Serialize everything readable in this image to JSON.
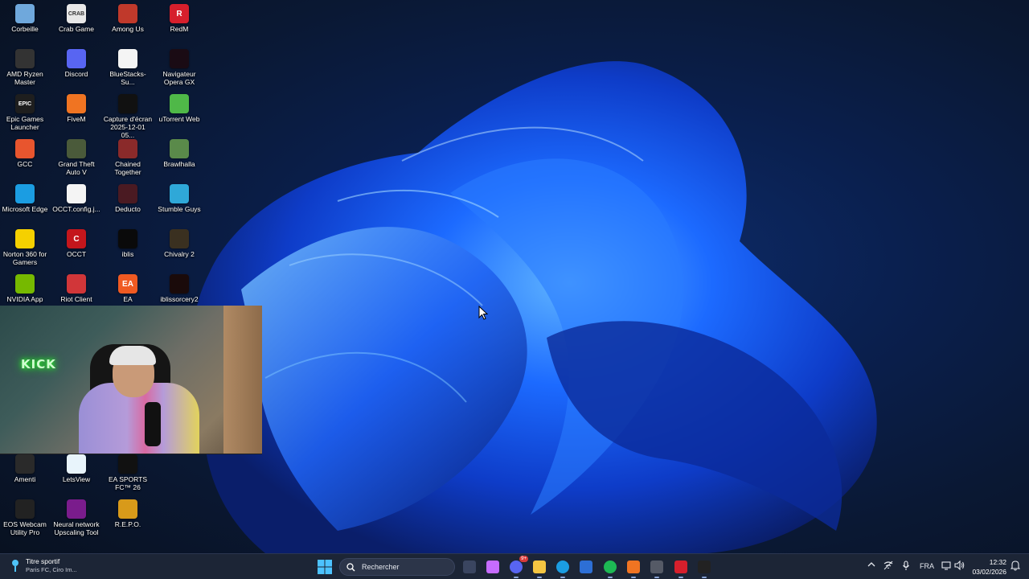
{
  "desktop": {
    "icons": [
      {
        "label": "Corbeille",
        "icon": "recycle-bin-icon",
        "color": "#6fa8dc"
      },
      {
        "label": "Crab Game",
        "icon": "crab-game-icon",
        "color": "#e8e8e8",
        "glyph": "CRAB"
      },
      {
        "label": "Among Us",
        "icon": "among-us-icon",
        "color": "#c0392b"
      },
      {
        "label": "RedM",
        "icon": "redm-icon",
        "color": "#d61f2c",
        "glyph": "R"
      },
      {
        "label": "AMD Ryzen Master",
        "icon": "amd-ryzen-master-icon",
        "color": "#333333"
      },
      {
        "label": "Discord",
        "icon": "discord-icon",
        "color": "#5865f2"
      },
      {
        "label": "BlueStacks-Su...",
        "icon": "file-icon",
        "color": "#f4f4f4"
      },
      {
        "label": "Navigateur Opera GX",
        "icon": "opera-gx-icon",
        "color": "#1a0b14"
      },
      {
        "label": "Epic Games Launcher",
        "icon": "epic-games-icon",
        "color": "#1e1e1e",
        "glyph": "EPIC"
      },
      {
        "label": "FiveM",
        "icon": "fivem-icon",
        "color": "#f07422"
      },
      {
        "label": "Capture d'écran 2025-12-01 05...",
        "icon": "screenshot-file-icon",
        "color": "#111111"
      },
      {
        "label": "uTorrent Web",
        "icon": "utorrent-icon",
        "color": "#4fb848"
      },
      {
        "label": "GCC",
        "icon": "gcc-icon",
        "color": "#e8552e"
      },
      {
        "label": "Grand Theft Auto V",
        "icon": "gta-v-icon",
        "color": "#4a5a3a"
      },
      {
        "label": "Chained Together",
        "icon": "chained-together-icon",
        "color": "#8a2a2a"
      },
      {
        "label": "Brawlhalla",
        "icon": "brawlhalla-icon",
        "color": "#5a8a4a"
      },
      {
        "label": "Microsoft Edge",
        "icon": "edge-icon",
        "color": "#1b9de2"
      },
      {
        "label": "OCCT.config.j...",
        "icon": "file-icon",
        "color": "#f4f4f4"
      },
      {
        "label": "Deducto",
        "icon": "deducto-icon",
        "color": "#4a1a22"
      },
      {
        "label": "Stumble Guys",
        "icon": "stumble-guys-icon",
        "color": "#2fa8d8"
      },
      {
        "label": "Norton 360 for Gamers",
        "icon": "norton-icon",
        "color": "#f5d000"
      },
      {
        "label": "OCCT",
        "icon": "occt-icon",
        "color": "#c4161c",
        "glyph": "C"
      },
      {
        "label": "iblis",
        "icon": "iblis-icon",
        "color": "#0a0a0a"
      },
      {
        "label": "Chivalry 2",
        "icon": "chivalry-2-icon",
        "color": "#3a3020"
      },
      {
        "label": "NVIDIA App",
        "icon": "nvidia-icon",
        "color": "#76b900"
      },
      {
        "label": "Riot Client",
        "icon": "riot-client-icon",
        "color": "#d13639"
      },
      {
        "label": "EA",
        "icon": "ea-icon",
        "color": "#f05a22",
        "glyph": "EA"
      },
      {
        "label": "iblissorcery2",
        "icon": "iblissorcery2-icon",
        "color": "#1a0a0a"
      },
      {
        "label": "Amenti",
        "icon": "amenti-icon",
        "color": "#2a2a2a"
      },
      {
        "label": "LetsView",
        "icon": "letsview-icon",
        "color": "#e8f4fb"
      },
      {
        "label": "EA SPORTS FC™ 26",
        "icon": "ea-sports-fc-icon",
        "color": "#111111"
      },
      {
        "label": "EOS Webcam Utility Pro",
        "icon": "eos-webcam-icon",
        "color": "#222222"
      },
      {
        "label": "Neural network Upscaling Tool",
        "icon": "upscaling-tool-icon",
        "color": "#7a1c8c"
      },
      {
        "label": "R.E.P.O.",
        "icon": "repo-icon",
        "color": "#d89a1a"
      }
    ]
  },
  "webcam": {
    "sign_text": "KICK"
  },
  "taskbar": {
    "weather": {
      "title": "Titre sportif",
      "subtitle": "Paris FC, Ciro Im..."
    },
    "search_placeholder": "Rechercher",
    "apps": [
      {
        "name": "task-view-app",
        "color": "#3a4560"
      },
      {
        "name": "copilot-app",
        "color": "#c66cff"
      },
      {
        "name": "discord-app",
        "color": "#5865f2",
        "badge": "9+"
      },
      {
        "name": "file-explorer-app",
        "color": "#f4c542"
      },
      {
        "name": "edge-app",
        "color": "#1b9de2"
      },
      {
        "name": "microsoft-store-app",
        "color": "#2d6fd6"
      },
      {
        "name": "spotify-app",
        "color": "#1db954"
      },
      {
        "name": "fivem-app",
        "color": "#f07422"
      },
      {
        "name": "gcc-app",
        "color": "#555a66"
      },
      {
        "name": "redm-app",
        "color": "#d61f2c"
      },
      {
        "name": "nvidia-broadcast-app",
        "color": "#222222"
      }
    ],
    "tray": {
      "language": "FRA"
    },
    "clock": {
      "time": "12:32",
      "date": "03/02/2026"
    }
  }
}
